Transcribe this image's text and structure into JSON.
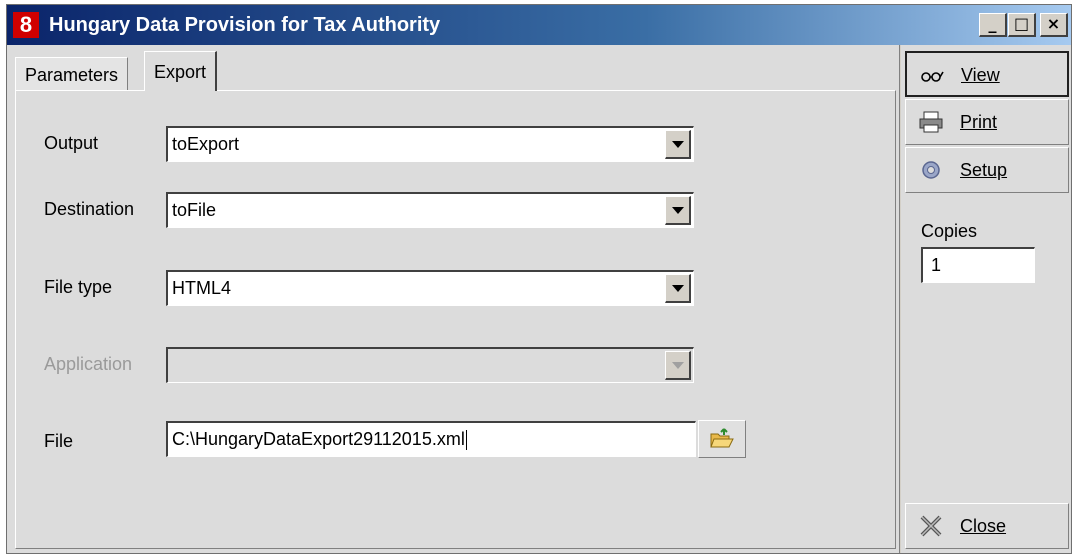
{
  "window": {
    "app_icon_label": "8",
    "title": "Hungary Data Provision for Tax Authority",
    "min_glyph": "_",
    "max_glyph": "□",
    "close_glyph": "×"
  },
  "tabs": [
    {
      "label": "Parameters",
      "active": false
    },
    {
      "label": "Export",
      "active": true
    }
  ],
  "form": {
    "output": {
      "label": "Output",
      "value": "toExport",
      "enabled": true
    },
    "destination": {
      "label": "Destination",
      "value": "toFile",
      "enabled": true
    },
    "file_type": {
      "label": "File type",
      "value": "HTML4",
      "enabled": true
    },
    "application": {
      "label": "Application",
      "value": "",
      "enabled": false
    },
    "file": {
      "label": "File",
      "value": "C:\\HungaryDataExport29112015.xml"
    }
  },
  "side_panel": {
    "view_label": "View",
    "print_label": "Print",
    "setup_label": "Setup",
    "copies_label": "Copies",
    "copies_value": "1",
    "close_label": "Close"
  },
  "icons": {
    "view": "glasses-icon",
    "print": "printer-icon",
    "setup": "gear-icon",
    "close": "close-x-icon",
    "browse": "folder-open-icon"
  }
}
